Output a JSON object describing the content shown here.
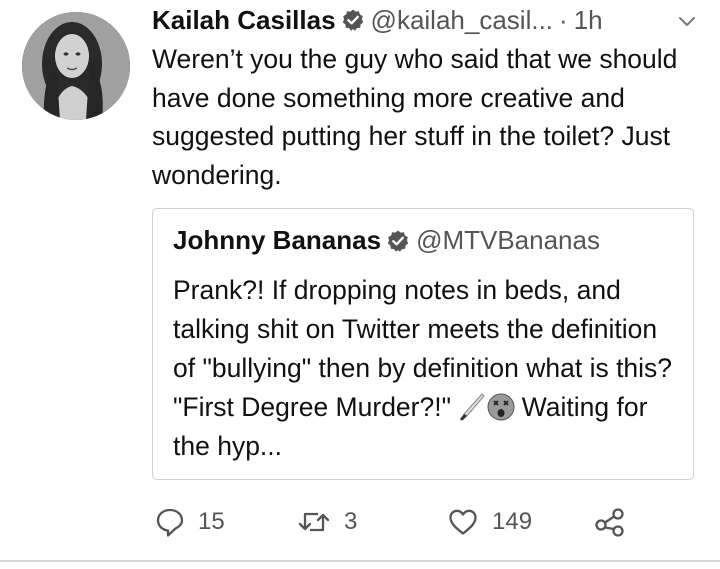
{
  "tweet": {
    "author": {
      "display_name": "Kailah Casillas",
      "handle": "@kailah_casil...",
      "verified_icon": "verified-badge-icon",
      "avatar_icon": "profile-photo"
    },
    "separator": "·",
    "timestamp": "1h",
    "menu_icon": "chevron-down-icon",
    "text": "Weren’t you the guy who said that we should have done something more creative and suggested putting her stuff in the toilet? Just wondering."
  },
  "quoted_tweet": {
    "author": {
      "display_name": "Johnny Bananas",
      "handle": "@MTVBananas",
      "verified_icon": "verified-badge-icon"
    },
    "text_before_emoji": "Prank?! If dropping notes in beds, and talking shit on Twitter meets the definition of \"bullying\" then by definition what is this? \"First Degree Murder?!\"",
    "emojis": [
      "knife-emoji",
      "dizzy-face-emoji"
    ],
    "text_after_emoji": "Waiting for the hyp..."
  },
  "actions": {
    "reply": {
      "icon": "reply-icon",
      "count": "15"
    },
    "retweet": {
      "icon": "retweet-icon",
      "count": "3"
    },
    "like": {
      "icon": "heart-icon",
      "count": "149"
    },
    "share": {
      "icon": "share-icon"
    }
  },
  "colors": {
    "text": "#111111",
    "secondary_text": "#555555",
    "border": "#d0d0d0",
    "background": "#ffffff"
  }
}
